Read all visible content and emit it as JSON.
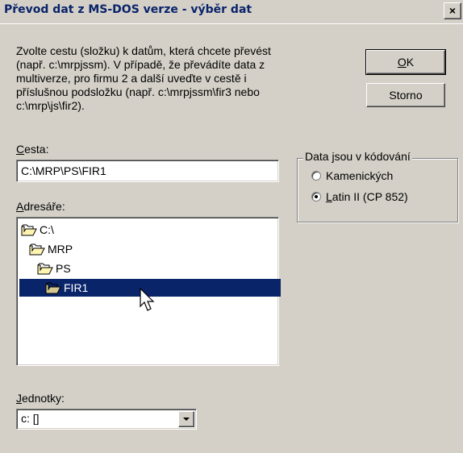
{
  "window": {
    "title": "Převod dat z MS-DOS verze - výběr dat",
    "close_label": "×"
  },
  "description": "Zvolte cestu (složku) k datům, která chcete převést\n(např. c:\\mrpjssm). V případě, že převádíte data z\nmultiverze, pro firmu 2 a další uveďte v cestě i\npříslušnou podsložku (např. c:\\mrpjssm\\fir3 nebo\nc:\\mrp\\js\\fir2).",
  "buttons": {
    "ok_mnemonic": "O",
    "ok_rest": "K",
    "cancel": "Storno"
  },
  "path": {
    "label_mnemonic": "C",
    "label_rest": "esta:",
    "value": "C:\\MRP\\PS\\FIR1"
  },
  "directories": {
    "label_mnemonic": "A",
    "label_rest": "dresáře:",
    "items": [
      {
        "name": "C:\\",
        "depth": 0,
        "open": true,
        "selected": false
      },
      {
        "name": "MRP",
        "depth": 1,
        "open": true,
        "selected": false
      },
      {
        "name": "PS",
        "depth": 2,
        "open": true,
        "selected": false
      },
      {
        "name": "FIR1",
        "depth": 3,
        "open": true,
        "selected": true
      }
    ]
  },
  "drives": {
    "label_mnemonic": "J",
    "label_rest": "ednotky:",
    "value": "c: []"
  },
  "encoding": {
    "legend": "Data jsou v kódování",
    "options": [
      {
        "mnemonic": "",
        "rest": "Kamenických",
        "checked": false
      },
      {
        "mnemonic": "L",
        "rest": "atin II (CP 852)",
        "checked": true
      }
    ]
  },
  "colors": {
    "title_text": "#0a246a",
    "selection": "#0a246a",
    "dialog_bg": "#d4d0c8"
  }
}
